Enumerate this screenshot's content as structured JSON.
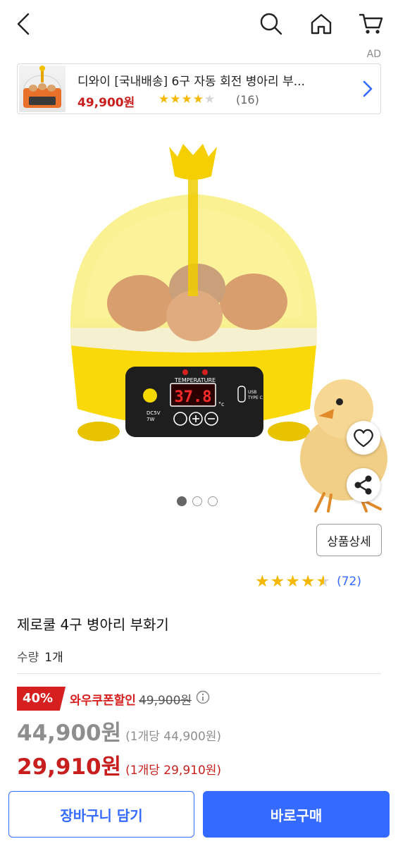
{
  "header": {
    "icons": [
      "back-arrow-icon",
      "search-icon",
      "home-icon",
      "cart-icon"
    ]
  },
  "ad": {
    "label": "AD",
    "title": "디와이 [국내배송] 6구 자동 회전 병아리 부...",
    "price": "49,900원",
    "rating": 4,
    "stars": "★★★★",
    "star_empty": "★",
    "review_count": "(16)"
  },
  "gallery": {
    "display_temp": "37.8",
    "display_unit": "°c",
    "panel_label": "TEMPERATURE",
    "power_label": "DC5V",
    "power_label_2": "7W",
    "usb_label": "USB",
    "usb_label_2": "TYPE C",
    "page_count": 3,
    "active_page": 1
  },
  "detail_button": "상품상세",
  "rating": {
    "value": 4.5,
    "stars_full": "★★★★",
    "star_half": "★",
    "count": "(72)"
  },
  "product": {
    "title": "제로쿨 4구 병아리 부화기",
    "qty_label": "수량",
    "qty_value": "1개"
  },
  "pricing": {
    "discount_pct": "40%",
    "coupon_label": "와우쿠폰할인",
    "original_price": "49,900원",
    "sale_price": "44,900원",
    "sale_unit": "(1개당 44,900원)",
    "coupon_price": "29,910원",
    "coupon_unit": "(1개당 29,910원)"
  },
  "buttons": {
    "cart": "장바구니 담기",
    "buy": "바로구매"
  },
  "colors": {
    "brand_blue": "#346aff",
    "price_red": "#c81e1e",
    "star_yellow": "#f5b800"
  }
}
